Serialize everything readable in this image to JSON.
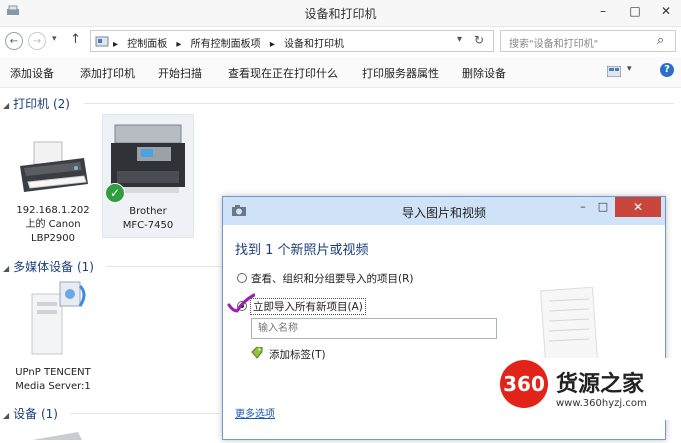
{
  "window": {
    "title": "设备和打印机",
    "min": "–",
    "max": "□",
    "close": "✕"
  },
  "address": {
    "back": "←",
    "forward": "→",
    "dropdown": "▾",
    "up": "↑",
    "crumbs": [
      "控制面板",
      "所有控制面板项",
      "设备和打印机"
    ],
    "sep": "▸",
    "history_dropdown": "▾",
    "refresh": "↻",
    "search_placeholder": "搜索\"设备和打印机\"",
    "search_icon": "⌕"
  },
  "toolbar": {
    "items": [
      "添加设备",
      "添加打印机",
      "开始扫描",
      "查看现在正在打印什么",
      "打印服务器属性",
      "删除设备"
    ],
    "view_dropdown": "▾",
    "help": "?"
  },
  "groups": {
    "printers": "打印机 (2)",
    "multimedia": "多媒体设备 (1)",
    "devices": "设备 (1)"
  },
  "devices": {
    "canon": [
      "192.168.1.202",
      "上的 Canon",
      "LBP2900"
    ],
    "brother": [
      "Brother",
      "MFC-7450"
    ],
    "upnp": [
      "UPnP TENCENT",
      "Media Server:1"
    ]
  },
  "dialog": {
    "title": "导入图片和视频",
    "heading": "找到 1 个新照片或视频",
    "option1": "查看、组织和分组要导入的项目(R)",
    "option2": "立即导入所有新项目(A)",
    "name_placeholder": "输入名称",
    "add_tags": "添加标签(T)",
    "more_options": "更多选项",
    "min": "–",
    "max": "□",
    "close": "✕"
  },
  "watermark": {
    "logo": "360",
    "name": "货源之家",
    "url": "www.360hyzj.com"
  },
  "colors": {
    "accent": "#1a3e7a",
    "close_red": "#c9463d",
    "dialog_title": "#cfe2f7",
    "check_green": "#2e9e3e",
    "watermark_red": "#e2231a"
  }
}
